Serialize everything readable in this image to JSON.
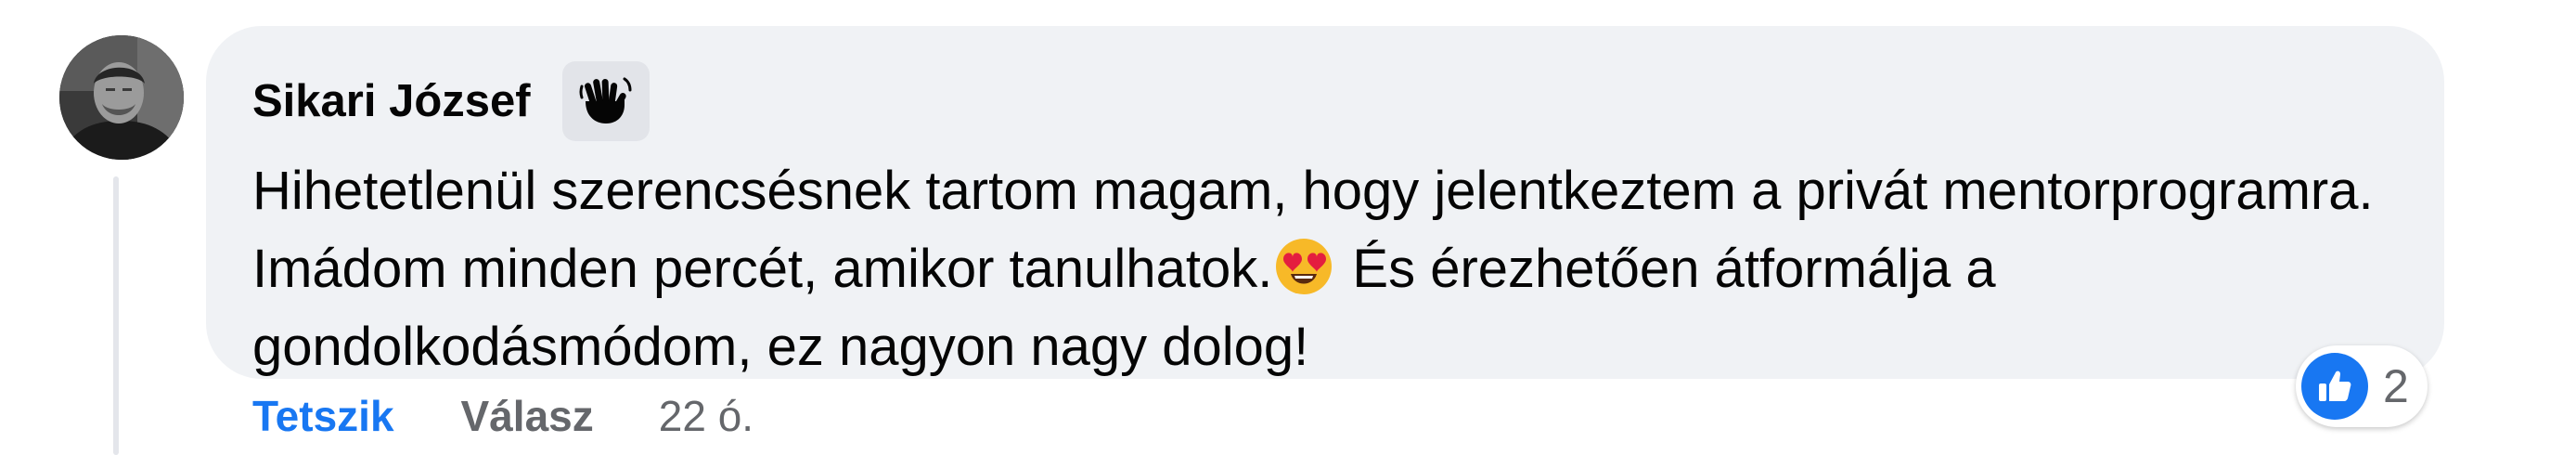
{
  "comment": {
    "author": "Sikari József",
    "badge_icon": "waving-hands-icon",
    "text_before_emoji": "Hihetetlenül szerencsésnek tartom magam, hogy jelentkeztem a privát mentorprogramra. Imádom minden percét, amikor tanulhatok.",
    "emoji": "heart-eyes-emoji",
    "text_after_emoji": " És érezhetően átformálja a gondolkodásmódom, ez nagyon nagy dolog!",
    "reaction_icon": "like-icon",
    "reaction_count": "2"
  },
  "actions": {
    "like_label": "Tetszik",
    "reply_label": "Válasz",
    "time_label": "22 ó."
  },
  "colors": {
    "bubble_bg": "#f0f2f5",
    "like_blue": "#1877f2",
    "secondary_text": "#65676b"
  }
}
